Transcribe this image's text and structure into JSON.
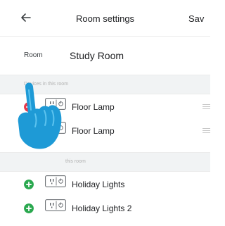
{
  "header": {
    "title": "Room settings",
    "save_label": "Sav",
    "back_icon": "arrow-left-icon"
  },
  "room": {
    "label": "Room",
    "name": "Study Room"
  },
  "sections": {
    "in_room": "Devices in this room",
    "not_in_room": "this room"
  },
  "devices_in_room": [
    {
      "name": "Floor Lamp",
      "action": "remove",
      "icon": "plug-icon"
    },
    {
      "name": "Floor Lamp",
      "action": "remove",
      "icon": "plug-icon"
    }
  ],
  "devices_available": [
    {
      "name": "Holiday Lights",
      "action": "add",
      "icon": "plug-icon"
    },
    {
      "name": "Holiday Lights 2",
      "action": "add",
      "icon": "plug-icon"
    }
  ],
  "colors": {
    "remove": "#e8394a",
    "add": "#2aa84f",
    "hand": "#1e9ad6",
    "section_bg": "#f1f3f4"
  }
}
